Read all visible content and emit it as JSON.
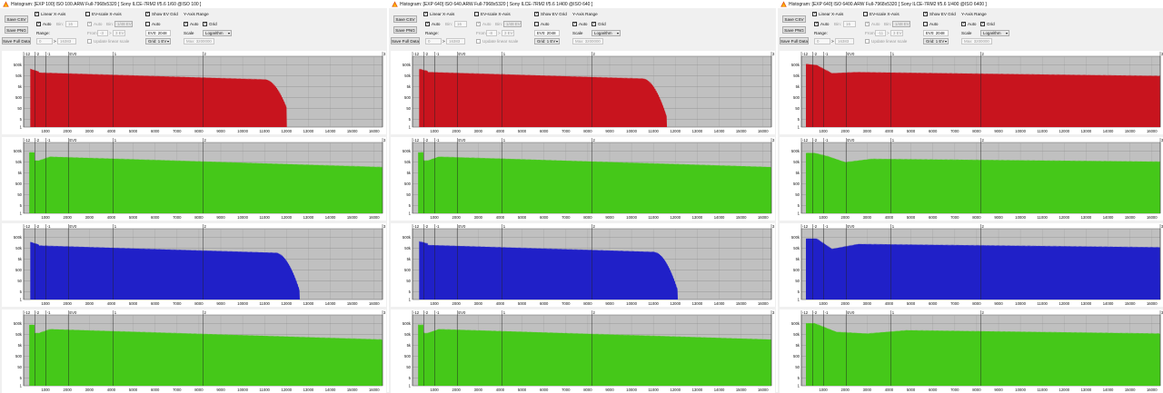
{
  "panels": [
    {
      "title": "Histogram: [EXP 100] ISO 100.ARW Full-7968x5320 [ Sony ILCE-7RM2 f/5.6 1/60 @ISO 100 ]",
      "toolbar": {
        "save_csv": "Save CSV",
        "save_png": "Save PNG",
        "save_full_data": "Save Full Data",
        "linear_x_axis": "Linear X-Axis",
        "auto": "Auto",
        "bin": "Bin:",
        "bin_value": "16",
        "range": "Range:",
        "range_from": "0",
        "range_sep": ">",
        "range_to": "16383",
        "ev_scale": "EV-scale X-Axis",
        "ev_auto": "Auto",
        "ev_bin": "Bin:",
        "ev_bin_value": "1/48 EV",
        "from_label": "From:",
        "from_value": "-3",
        "from_to": "3 EV",
        "update_linear": "Update linear scale",
        "show_ev_grid": "Show EV Grid",
        "grid_auto": "Auto",
        "ev0_value": "EV0: 2048",
        "grid_step": "Grid: 1 EV",
        "y_axis_range": "Y-Axis Range",
        "y_auto": "Auto",
        "y_grid": "Grid",
        "scale": "Scale",
        "scale_value": "Logarithm",
        "max_label": "Max: 3200000"
      },
      "channels": [
        {
          "color": "#c8141e",
          "shape": "clip_red_100"
        },
        {
          "color": "#45c819",
          "shape": "green_flat"
        },
        {
          "color": "#2020c8",
          "shape": "clip_blue_100"
        },
        {
          "color": "#45c819",
          "shape": "green_flat"
        }
      ]
    },
    {
      "title": "Histogram: [EXP 640] ISO 640.ARW Full-7968x5320 [ Sony ILCE-7RM2 f/5.6 1/400 @ISO 640 ]",
      "toolbar": {
        "save_csv": "Save CSV",
        "save_png": "Save PNG",
        "save_full_data": "Save Full Data",
        "linear_x_axis": "Linear X-Axis",
        "auto": "Auto",
        "bin": "Bin:",
        "bin_value": "16",
        "range": "Range:",
        "range_from": "0",
        "range_sep": ">",
        "range_to": "16383",
        "ev_scale": "EV-scale X-Axis",
        "ev_auto": "Auto",
        "ev_bin": "Bin:",
        "ev_bin_value": "1/48 EV",
        "from_label": "From:",
        "from_value": "-8",
        "from_to": "3 EV",
        "update_linear": "Update linear scale",
        "show_ev_grid": "Show EV Grid",
        "grid_auto": "Auto",
        "ev0_value": "EV0: 2048",
        "grid_step": "Grid: 1 EV",
        "y_axis_range": "Y-Axis Range",
        "y_auto": "Auto",
        "y_grid": "Grid",
        "scale": "Scale",
        "scale_value": "Logarithm",
        "max_label": "Max: 3200000"
      },
      "channels": [
        {
          "color": "#c8141e",
          "shape": "clip_red_640"
        },
        {
          "color": "#45c819",
          "shape": "green_flat"
        },
        {
          "color": "#2020c8",
          "shape": "clip_blue_640"
        },
        {
          "color": "#45c819",
          "shape": "green_flat"
        }
      ]
    },
    {
      "title": "Histogram: [EXP 640] ISO 6400.ARW Full-7968x5320 [ Sony ILCE-7RM2 f/5.6 1/400 @ISO 6400 ]",
      "toolbar": {
        "save_csv": "Save CSV",
        "save_png": "Save PNG",
        "save_full_data": "Save Full Data",
        "linear_x_axis": "Linear X-Axis",
        "auto": "Auto",
        "bin": "Bin:",
        "bin_value": "16",
        "range": "Range:",
        "range_from": "0",
        "range_sep": ">",
        "range_to": "16383",
        "ev_scale": "EV-scale X-Axis",
        "ev_auto": "Auto",
        "ev_bin": "Bin:",
        "ev_bin_value": "1/48 EV",
        "from_label": "From:",
        "from_value": "-11",
        "from_to": "3 EV",
        "update_linear": "Update linear scale",
        "show_ev_grid": "Show EV Grid",
        "grid_auto": "Auto",
        "ev0_value": "EV0: 2048",
        "grid_step": "Grid: 1 EV",
        "y_axis_range": "Y-Axis Range",
        "y_auto": "Auto",
        "y_grid": "Grid",
        "scale": "Scale",
        "scale_value": "Logarithm",
        "max_label": "Max: 3200000"
      },
      "channels": [
        {
          "color": "#c8141e",
          "shape": "noisy_red"
        },
        {
          "color": "#45c819",
          "shape": "noisy_green"
        },
        {
          "color": "#2020c8",
          "shape": "noisy_blue"
        },
        {
          "color": "#45c819",
          "shape": "noisy_green2"
        }
      ]
    }
  ],
  "chart_data": {
    "type": "area",
    "x_range": [
      0,
      16383
    ],
    "x_ticks": [
      "1000",
      "2000",
      "3000",
      "4000",
      "5000",
      "6000",
      "7000",
      "8000",
      "9000",
      "10000",
      "11000",
      "12000",
      "13000",
      "14000",
      "15000",
      "16000"
    ],
    "ev_ticks": [
      {
        "label": "-12",
        "value": 0.5
      },
      {
        "label": "-2",
        "value": 512
      },
      {
        "label": "-1",
        "value": 1024
      },
      {
        "label": "EV0",
        "value": 2048
      },
      {
        "label": "1",
        "value": 4096
      },
      {
        "label": "2",
        "value": 8192
      },
      {
        "label": "3",
        "value": 16383
      }
    ],
    "y_scale": "log",
    "y_range": [
      1,
      3200000
    ],
    "y_ticks": [
      {
        "label": "500k",
        "value": 500000
      },
      {
        "label": "50k",
        "value": 50000
      },
      {
        "label": "5k",
        "value": 5000
      },
      {
        "label": "500",
        "value": 500
      },
      {
        "label": "50",
        "value": 50
      },
      {
        "label": "5",
        "value": 5
      },
      {
        "label": "1",
        "value": 1
      }
    ],
    "grid": true
  }
}
